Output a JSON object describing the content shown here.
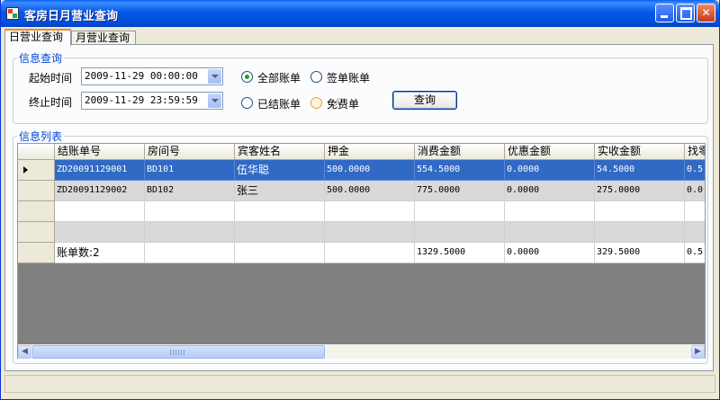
{
  "window": {
    "title": "客房日月营业查询"
  },
  "tabs": [
    {
      "label": "日营业查询",
      "active": true
    },
    {
      "label": "月营业查询",
      "active": false
    }
  ],
  "query": {
    "legend": "信息查询",
    "start_label": "起始时间",
    "start_value": "2009-11-29 00:00:00",
    "end_label": "终止时间",
    "end_value": "2009-11-29 23:59:59",
    "radio_all": "全部账单",
    "radio_sign": "签单账单",
    "radio_settled": "已结账单",
    "radio_free_prefix": "免",
    "radio_free_suffix": "费单",
    "selected_radio": "全部账单",
    "search_button": "查询"
  },
  "list": {
    "legend": "信息列表",
    "columns": [
      "结账单号",
      "房间号",
      "宾客姓名",
      "押金",
      "消费金额",
      "优惠金额",
      "实收金额",
      "找零"
    ],
    "rows": [
      [
        "ZD20091129001",
        "BD101",
        "伍华聪",
        "500.0000",
        "554.5000",
        "0.0000",
        "54.5000",
        "0.5"
      ],
      [
        "ZD20091129002",
        "BD102",
        "张三",
        "500.0000",
        "775.0000",
        "0.0000",
        "275.0000",
        "0.0"
      ],
      [
        "",
        "",
        "",
        "",
        "",
        "",
        "",
        ""
      ],
      [
        "",
        "",
        "",
        "",
        "",
        "",
        "",
        ""
      ],
      [
        "账单数:2",
        "",
        "",
        "",
        "1329.5000",
        "0.0000",
        "329.5000",
        "0.5"
      ]
    ],
    "selected_row": 0
  },
  "icons": {
    "app": "app-icon",
    "minimize": "minimize-icon",
    "maximize": "maximize-icon",
    "close": "close-icon",
    "dropdown": "chevron-down-icon",
    "row_pointer": "row-pointer-icon",
    "scroll_left": "arrow-left-icon",
    "scroll_right": "arrow-right-icon",
    "cursor": "mouse-cursor-icon"
  },
  "colors": {
    "title_bar": "#0458E8",
    "selection": "#316AC5",
    "group_legend": "#0046D5",
    "tab_highlight": "#E68B2C"
  }
}
